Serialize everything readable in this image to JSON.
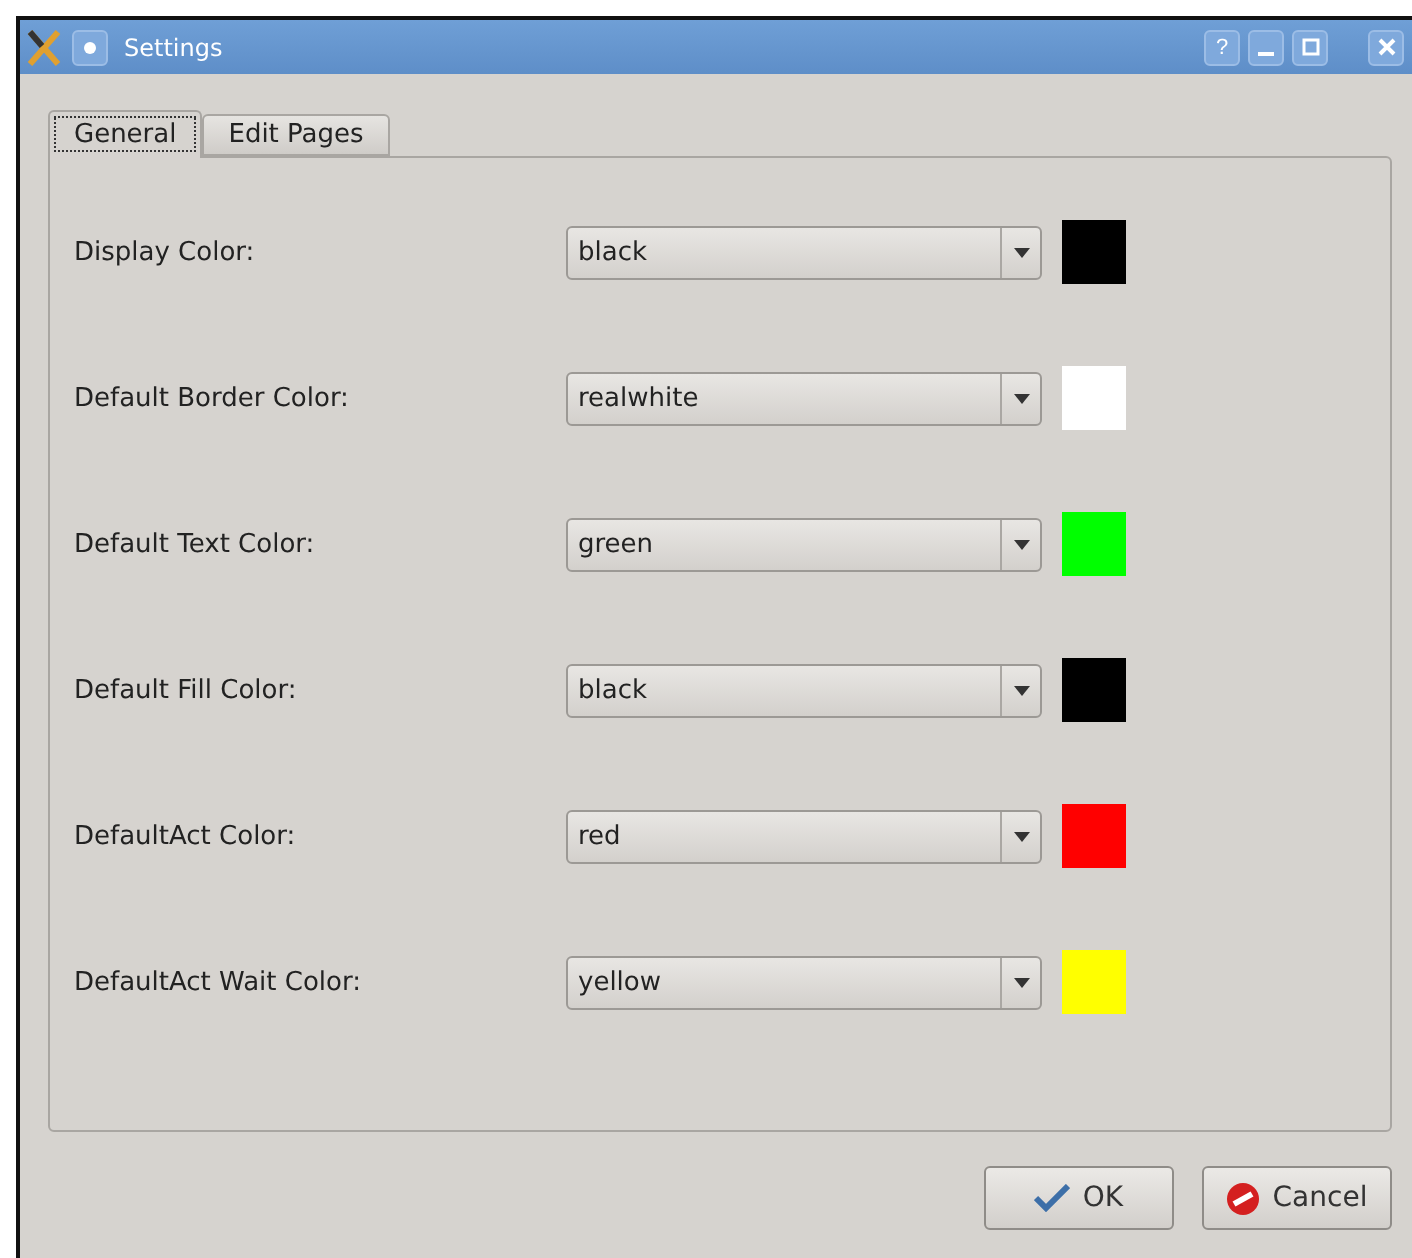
{
  "window": {
    "title": "Settings",
    "help_button": "?"
  },
  "tabs": [
    {
      "label": "General",
      "selected": true
    },
    {
      "label": "Edit Pages",
      "selected": false
    }
  ],
  "settings": [
    {
      "label": "Display Color:",
      "value": "black",
      "color": "#000000"
    },
    {
      "label": "Default Border Color:",
      "value": "realwhite",
      "color": "#ffffff"
    },
    {
      "label": "Default Text Color:",
      "value": "green",
      "color": "#00ff00"
    },
    {
      "label": "Default Fill Color:",
      "value": "black",
      "color": "#000000"
    },
    {
      "label": "DefaultAct Color:",
      "value": "red",
      "color": "#ff0000"
    },
    {
      "label": "DefaultAct Wait Color:",
      "value": "yellow",
      "color": "#ffff00"
    }
  ],
  "buttons": [
    {
      "label": "OK",
      "kind": "ok"
    },
    {
      "label": "Cancel",
      "kind": "cancel"
    }
  ]
}
